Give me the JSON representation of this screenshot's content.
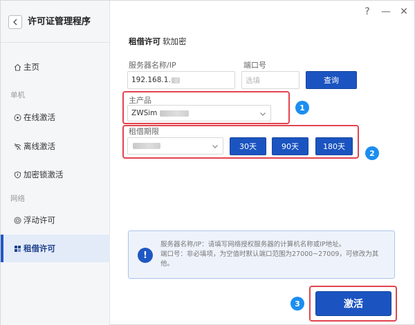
{
  "app": {
    "title": "许可证管理程序",
    "help_label": "?",
    "minimize_label": "—",
    "close_label": "✕"
  },
  "sidebar": {
    "home": "主页",
    "section_standalone": "单机",
    "online_activation": "在线激活",
    "offline_activation": "离线激活",
    "dongle_activation": "加密锁激活",
    "section_network": "网络",
    "floating_license": "浮动许可",
    "borrow_license": "租借许可"
  },
  "main": {
    "heading": "租借许可",
    "heading_sub": "软加密",
    "server_label": "服务器名称/IP",
    "server_value": "192.168.1.",
    "port_label": "端口号",
    "port_placeholder": "选填",
    "query_button": "查询",
    "product_label": "主产品",
    "product_value": "ZWSim",
    "period_label": "租借期限",
    "btn_30": "30天",
    "btn_90": "90天",
    "btn_180": "180天",
    "info_line1": "服务器名称/IP：请填写网络授权服务器的计算机名称或IP地址。",
    "info_line2": "端口号：非必填项，为空值时默认端口范围为27000~27009，可修改为其他。",
    "activate_button": "激活",
    "step1": "1",
    "step2": "2",
    "step3": "3",
    "info_icon": "!"
  },
  "colors": {
    "accent": "#1b54c0",
    "highlight_red": "#e2434f",
    "step_blue": "#1c8ef0",
    "sidebar_active": "#e3ebf8"
  }
}
